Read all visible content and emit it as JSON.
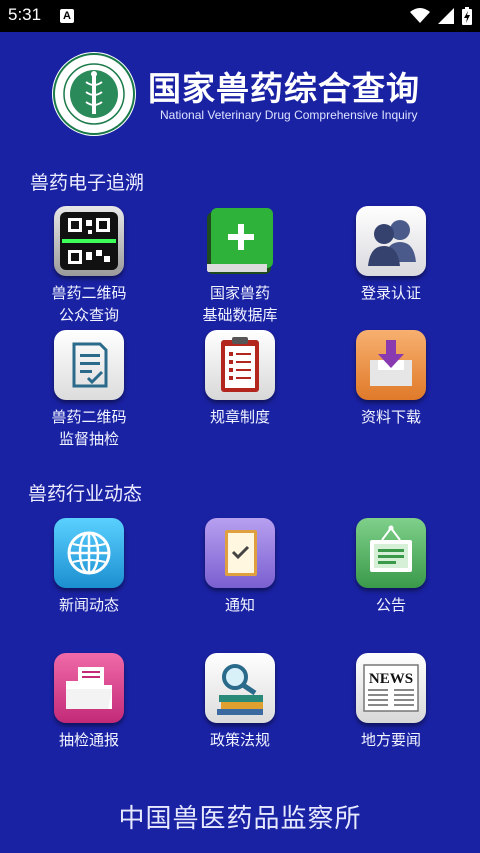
{
  "status_bar": {
    "time": "5:31",
    "notification_letter": "A"
  },
  "header": {
    "title": "国家兽药综合查询",
    "subtitle": "National Veterinary Drug Comprehensive Inquiry"
  },
  "sections": {
    "trace_title": "兽药电子追溯",
    "news_title": "兽药行业动态"
  },
  "tiles": {
    "qr_public": {
      "line1": "兽药二维码",
      "line2": "公众查询",
      "icon": "qr-scan-icon"
    },
    "database": {
      "line1": "国家兽药",
      "line2": "基础数据库",
      "icon": "green-book-plus-icon"
    },
    "login": {
      "line1": "登录认证",
      "icon": "users-icon"
    },
    "qr_inspect": {
      "line1": "兽药二维码",
      "line2": "监督抽检",
      "icon": "document-check-icon"
    },
    "regulations": {
      "line1": "规章制度",
      "icon": "clipboard-checklist-icon"
    },
    "download": {
      "line1": "资料下载",
      "icon": "download-tray-icon"
    },
    "news": {
      "line1": "新闻动态",
      "icon": "globe-icon"
    },
    "notice": {
      "line1": "通知",
      "icon": "notebook-check-icon"
    },
    "announcement": {
      "line1": "公告",
      "icon": "bulletin-board-icon"
    },
    "sampling_report": {
      "line1": "抽检通报",
      "icon": "open-folder-icon"
    },
    "policy": {
      "line1": "政策法规",
      "icon": "magnifier-books-icon"
    },
    "local_news": {
      "line1": "地方要闻",
      "icon": "newspaper-icon",
      "icon_text": "NEWS"
    }
  },
  "footer": {
    "text": "中国兽医药品监察所"
  },
  "colors": {
    "background": "#1a22a4",
    "status_bar": "#000000"
  }
}
